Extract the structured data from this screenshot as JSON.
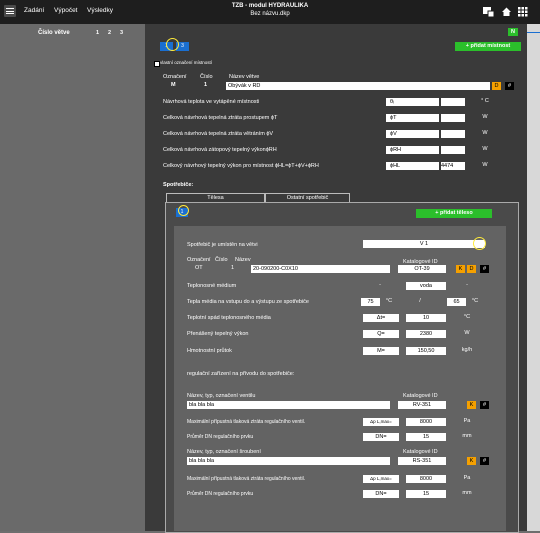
{
  "header": {
    "tabs": [
      "Zadání",
      "Výpočet",
      "Výsledky"
    ],
    "title": "TZB -  modul HYDRAULIKA",
    "subtitle": "Bez názvu.dkp"
  },
  "left": {
    "branch_label": "Číslo větve",
    "branch_numbers": [
      "1",
      "2",
      "3"
    ]
  },
  "main": {
    "n_button": "N",
    "tab_active": "1",
    "tab_other": "3",
    "add_room": "+ přidat místnost",
    "own_room_checkbox": "vlastní označení místností",
    "room": {
      "label_mark": "Označení",
      "label_number": "Číslo",
      "label_name": "Název větve",
      "mark": "M",
      "number": "1",
      "name": "Obývák v RD",
      "btn_d": "D",
      "btn_hash": "#"
    },
    "rows": [
      {
        "label": "Návrhová teplota ve vytápěné místnosti",
        "symbol": "θᵢ",
        "value": "",
        "unit": "° C"
      },
      {
        "label": "Celková návrhová tepelná ztráta prostupem ϕT",
        "symbol": "ϕT",
        "value": "",
        "unit": "W"
      },
      {
        "label": "Celková návrhová tepelná ztráta větráním ϕV",
        "symbol": "ϕV",
        "value": "",
        "unit": "W"
      },
      {
        "label": "Celková návrhová zátopový tepelný výkonϕRH",
        "symbol": "ϕRH",
        "value": "",
        "unit": "W"
      },
      {
        "label": "Celkový návrhový tepelný výkon pro  místnost ϕHL=ϕT+ϕV+ϕRH",
        "symbol": "ϕHL",
        "value": "4474",
        "unit": "W"
      }
    ],
    "consumers_label": "Spotřebiče:",
    "consumer_tabs": [
      "Tělesa",
      "Ostatní spotřebič"
    ],
    "body_tab_num": "1",
    "add_body": "+ přidat těleso",
    "location_label": "Spotřebič je umístěn na větvi",
    "location_value": "V 1",
    "body": {
      "label_mark": "Označení",
      "label_number": "Číslo",
      "label_name": "Název",
      "label_catalog": "Katalogové ID",
      "mark": "OT",
      "number": "1",
      "name": "20-090200-C0X10",
      "catalog": "OT-39",
      "btn_k": "K",
      "btn_d": "D",
      "btn_hash": "#"
    },
    "body_rows": [
      {
        "label": "Teplonosné médium",
        "a": "-",
        "b": "voda",
        "c": "-"
      },
      {
        "label": "Tepla média na vstupu do a výstupu ze spotřebiče",
        "a": "75",
        "a_unit": "°C",
        "sep": "/",
        "b": "65",
        "b_unit": "°C"
      },
      {
        "label": "Teplotní spád teplonosného média",
        "a": "Δt=",
        "b": "10",
        "c": "°C"
      },
      {
        "label": "Přenášený tepelný výkon",
        "a": "Q=",
        "b": "2380",
        "c": "W"
      },
      {
        "label": "Hmotnostní  průtok",
        "a": "M=",
        "b": "150,50",
        "c": "kg/h"
      }
    ],
    "regulation_label": "regulační zařízení na přívodu do spotřebiče:",
    "valve": {
      "label": "Název, typ, označení ventilu",
      "catalog_label": "Katalogové ID",
      "name": "bla bla bla",
      "catalog": "RV-351",
      "btn_k": "K",
      "btn_hash": "#",
      "row1_label": "Maximální přípustná tlaková ztráta regulačního ventil.",
      "row1_sym": "Δp L,max=",
      "row1_val": "8000",
      "row1_unit": "Pa",
      "row2_label": "Průměr DN regulačního prvku",
      "row2_sym": "DN=",
      "row2_val": "15",
      "row2_unit": "mm"
    },
    "fitting": {
      "label": "Název, typ, označení šroubení",
      "catalog_label": "Katalogové ID",
      "name": "bla bla bla",
      "catalog": "RS-351",
      "btn_k": "K",
      "btn_hash": "#",
      "row1_label": "Maximální přípustná tlaková ztráta regulačního ventil.",
      "row1_sym": "Δp L,max=",
      "row1_val": "8000",
      "row1_unit": "Pa",
      "row2_label": "Průměr DN regulačního prvku",
      "row2_sym": "DN=",
      "row2_val": "15",
      "row2_unit": "mm"
    }
  }
}
